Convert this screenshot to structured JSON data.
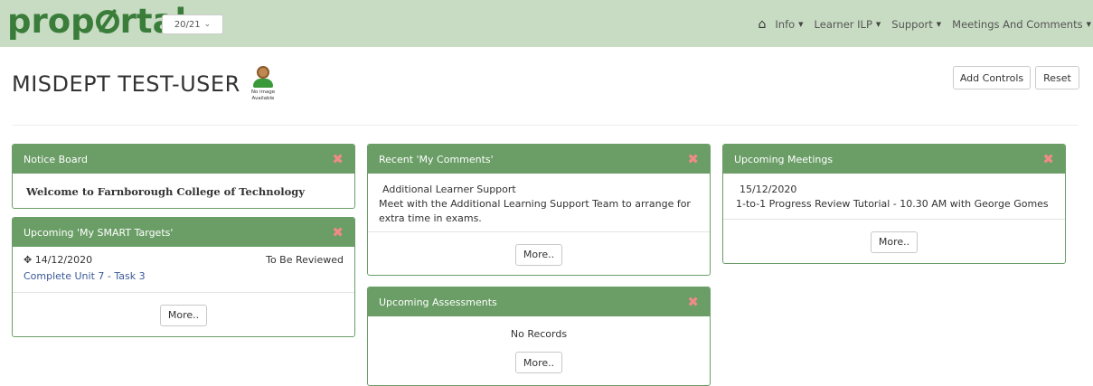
{
  "header": {
    "logo_parts": [
      "prop",
      "rtal"
    ],
    "year": "20/21",
    "nav": [
      {
        "label": "Info"
      },
      {
        "label": "Learner ILP"
      },
      {
        "label": "Support"
      },
      {
        "label": "Meetings And Comments"
      }
    ]
  },
  "user": {
    "name": "MISDEPT TEST-USER",
    "avatar_caption_1": "No image",
    "avatar_caption_2": "Available"
  },
  "controls": {
    "add": "Add Controls",
    "reset": "Reset"
  },
  "panels": {
    "notice": {
      "title": "Notice Board",
      "message": "Welcome to Farnborough College of Technology"
    },
    "targets": {
      "title": "Upcoming 'My SMART Targets'",
      "date": "14/12/2020",
      "status": "To Be Reviewed",
      "target": "Complete Unit 7 - Task 3",
      "more": "More.."
    },
    "comments": {
      "title": "Recent 'My Comments'",
      "heading": "Additional Learner Support",
      "text": "Meet with the Additional Learning Support Team to arrange for extra time in exams.",
      "more": "More.."
    },
    "assessments": {
      "title": "Upcoming Assessments",
      "empty": "No Records",
      "more": "More.."
    },
    "meetings": {
      "title": "Upcoming Meetings",
      "date": "15/12/2020",
      "text": "1-to-1 Progress Review Tutorial - 10.30 AM with George Gomes",
      "more": "More.."
    }
  },
  "colors": {
    "topbar": "#c8dcc3",
    "logo": "#3a7d3a",
    "panel_header": "#6a9e66",
    "close": "#f08a8a"
  },
  "icons": {
    "home": "home-icon",
    "close": "close-icon",
    "move": "move-icon",
    "caret": "caret-down-icon"
  }
}
